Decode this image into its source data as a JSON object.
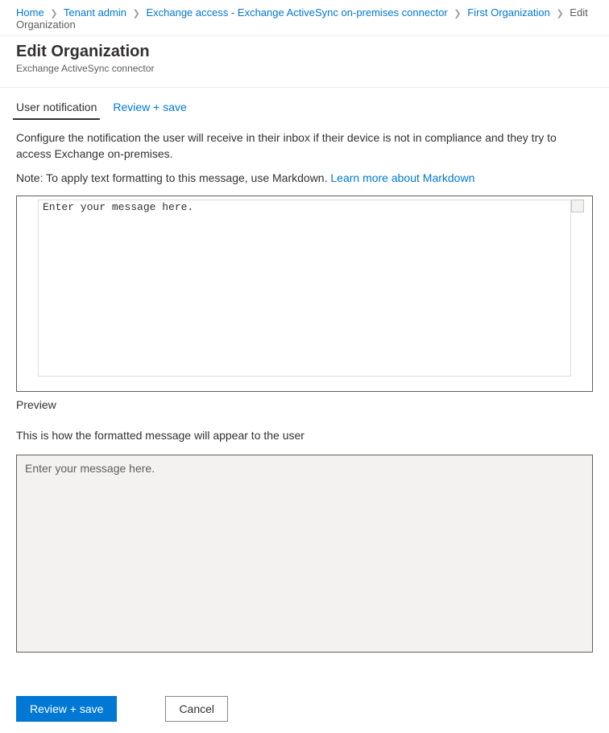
{
  "breadcrumb": {
    "items": [
      {
        "label": "Home"
      },
      {
        "label": "Tenant admin"
      },
      {
        "label": "Exchange access - Exchange ActiveSync on-premises connector"
      },
      {
        "label": "First Organization"
      }
    ],
    "current": "Edit Organization"
  },
  "header": {
    "title": "Edit Organization",
    "subtitle": "Exchange ActiveSync connector"
  },
  "tabs": {
    "items": [
      {
        "label": "User notification",
        "active": true
      },
      {
        "label": "Review + save",
        "active": false
      }
    ]
  },
  "main": {
    "description": "Configure the notification the user will receive in their inbox if their device is not in compliance and they try to access Exchange on-premises.",
    "note_prefix": "Note: To apply text formatting to this message, use Markdown. ",
    "note_link": "Learn more about Markdown",
    "editor_placeholder": "Enter your message here.",
    "preview_heading": "Preview",
    "preview_sub": "This is how the formatted message will appear to the user",
    "preview_content": "Enter your message here."
  },
  "footer": {
    "primary_label": "Review + save",
    "secondary_label": "Cancel"
  }
}
